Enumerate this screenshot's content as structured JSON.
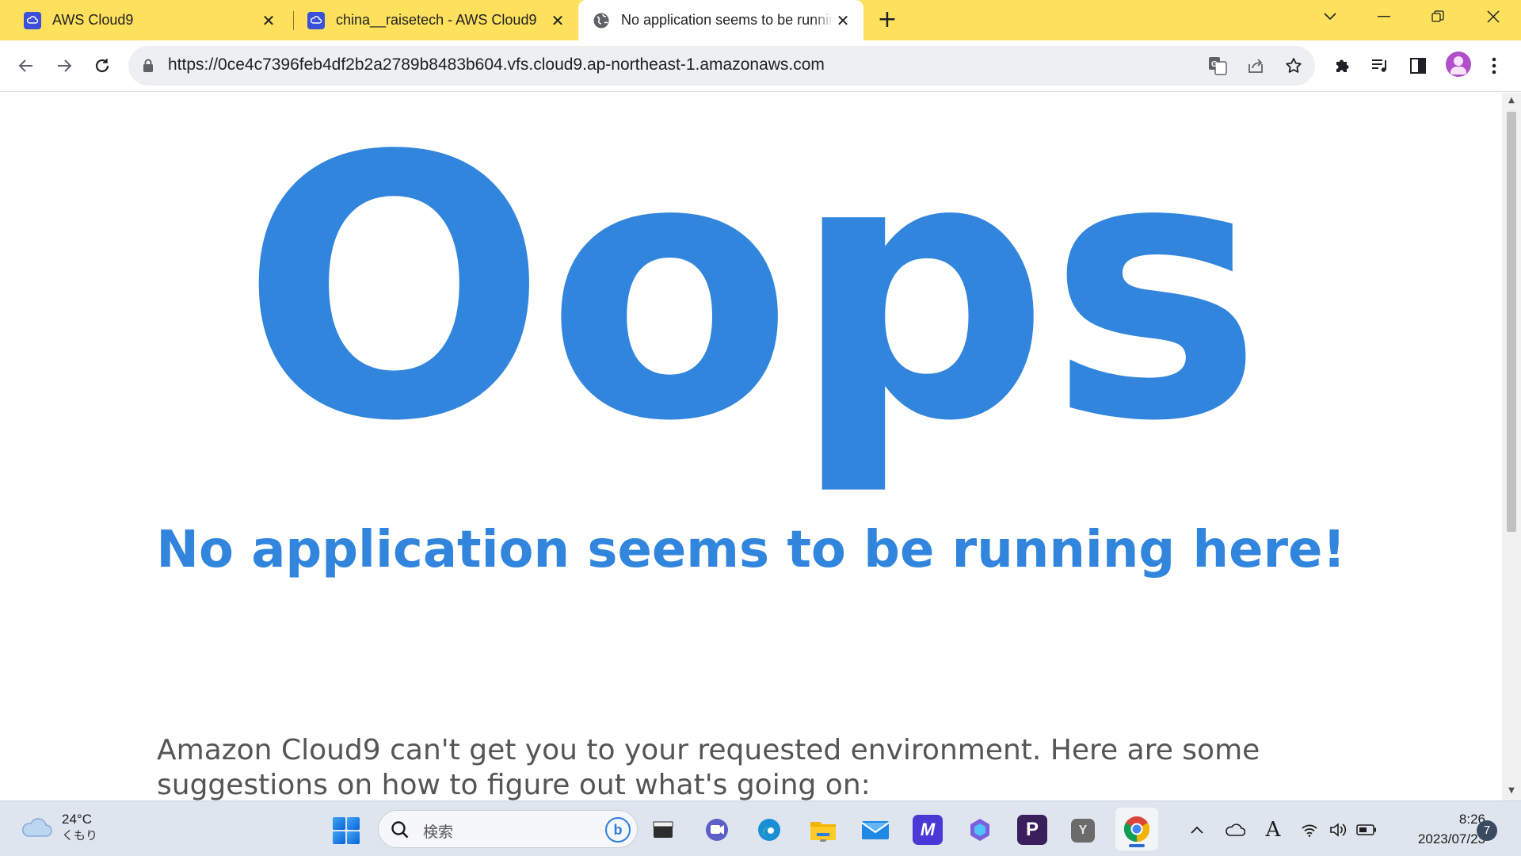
{
  "browser": {
    "tabs": [
      {
        "title": "AWS Cloud9",
        "icon": "cloud9-icon"
      },
      {
        "title": "china__raisetech - AWS Cloud9",
        "icon": "cloud9-icon"
      },
      {
        "title": "No application seems to be running here!",
        "icon": "globe-icon",
        "active": true
      }
    ],
    "new_tab_label": "+",
    "url": "https://0ce4c7396feb4df2b2a2789b8483b604.vfs.cloud9.ap-northeast-1.amazonaws.com"
  },
  "page": {
    "heading": "Oops",
    "subtitle": "No application seems to be running here!",
    "body": "Amazon Cloud9 can't get you to your requested environment. Here are some suggestions on how to figure out what's going on:"
  },
  "colors": {
    "accent": "#3185dc",
    "tabstrip": "#fde05c",
    "taskbar": "#dfe5ee"
  },
  "taskbar": {
    "weather": {
      "temp": "24°C",
      "condition": "くもり"
    },
    "search_placeholder": "検索",
    "apps": [
      "file-explorer-icon",
      "teams-icon",
      "edge-icon",
      "folder-icon",
      "mail-icon",
      "cursor-app-icon",
      "copilot-icon",
      "p-app-icon",
      "y-app-icon",
      "chrome-icon"
    ],
    "ime_label": "A",
    "clock": {
      "time": "8:26",
      "date": "2023/07/23"
    },
    "notification_count": "7"
  }
}
